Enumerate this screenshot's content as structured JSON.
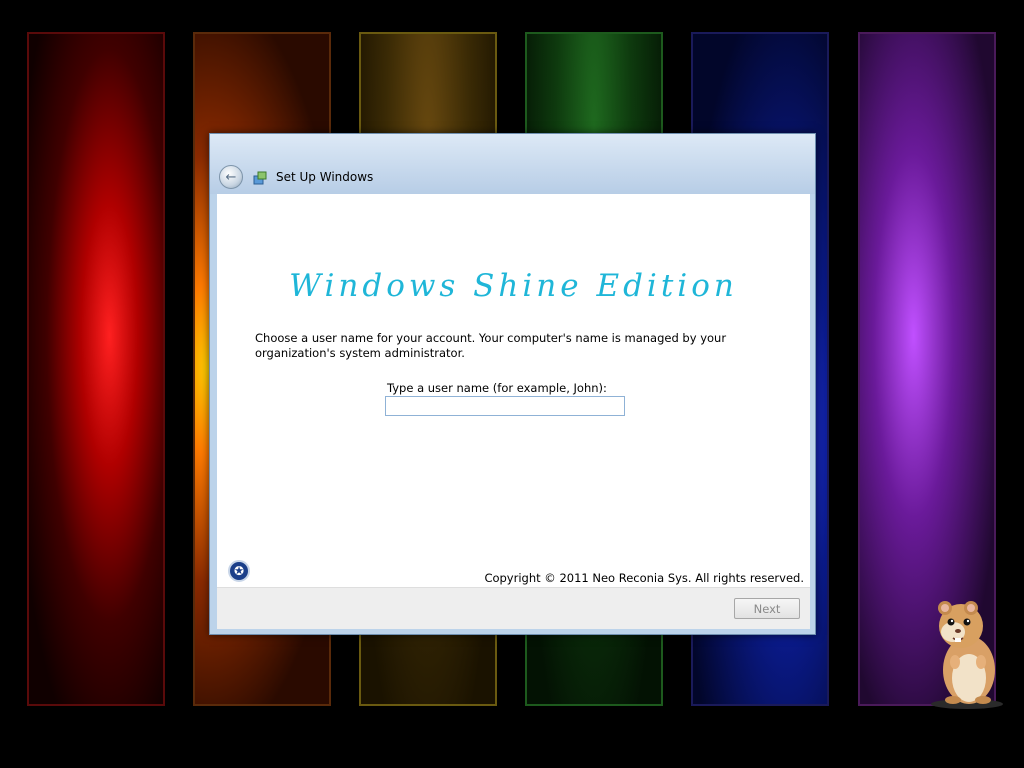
{
  "window": {
    "title": "Set Up Windows"
  },
  "content": {
    "brand_title": "Windows Shine Edition",
    "description": "Choose a user name for your account.  Your computer's name is managed by your organization's system administrator.",
    "username_label": "Type a user name (for example, John):",
    "username_value": "",
    "copyright": "Copyright © 2011 Neo Reconia Sys.  All rights reserved."
  },
  "footer": {
    "next_label": "Next"
  },
  "icons": {
    "back": "back-arrow-icon",
    "setup": "setup-icon",
    "accessibility": "ease-of-access-icon",
    "mascot": "hamster-icon"
  },
  "colors": {
    "brand_title": "#1fb6d8",
    "titlebar": "#bcd3ea",
    "footer": "#eeeeee",
    "disabled_text": "#8a8a8a"
  }
}
